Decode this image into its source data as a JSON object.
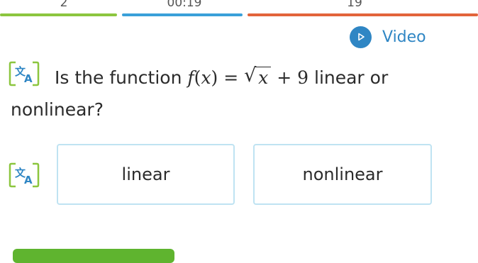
{
  "progress": {
    "questions_answered": "2",
    "timer": "00:19",
    "smart_score": "19",
    "colors": {
      "answered": "#8cc63f",
      "time": "#3aa0d9",
      "score": "#e2643b"
    }
  },
  "video": {
    "label": "Video",
    "icon": "play-icon",
    "color": "#2f86c4"
  },
  "question": {
    "intro": "Is the function",
    "func": "f",
    "var": "x",
    "radicand": "x",
    "plus": "+ 9",
    "line1_end": "linear or",
    "line2": "nonlinear?",
    "icon": "translate-icon"
  },
  "choices": [
    "linear",
    "nonlinear"
  ],
  "submit": {
    "color": "#5fb42f"
  }
}
